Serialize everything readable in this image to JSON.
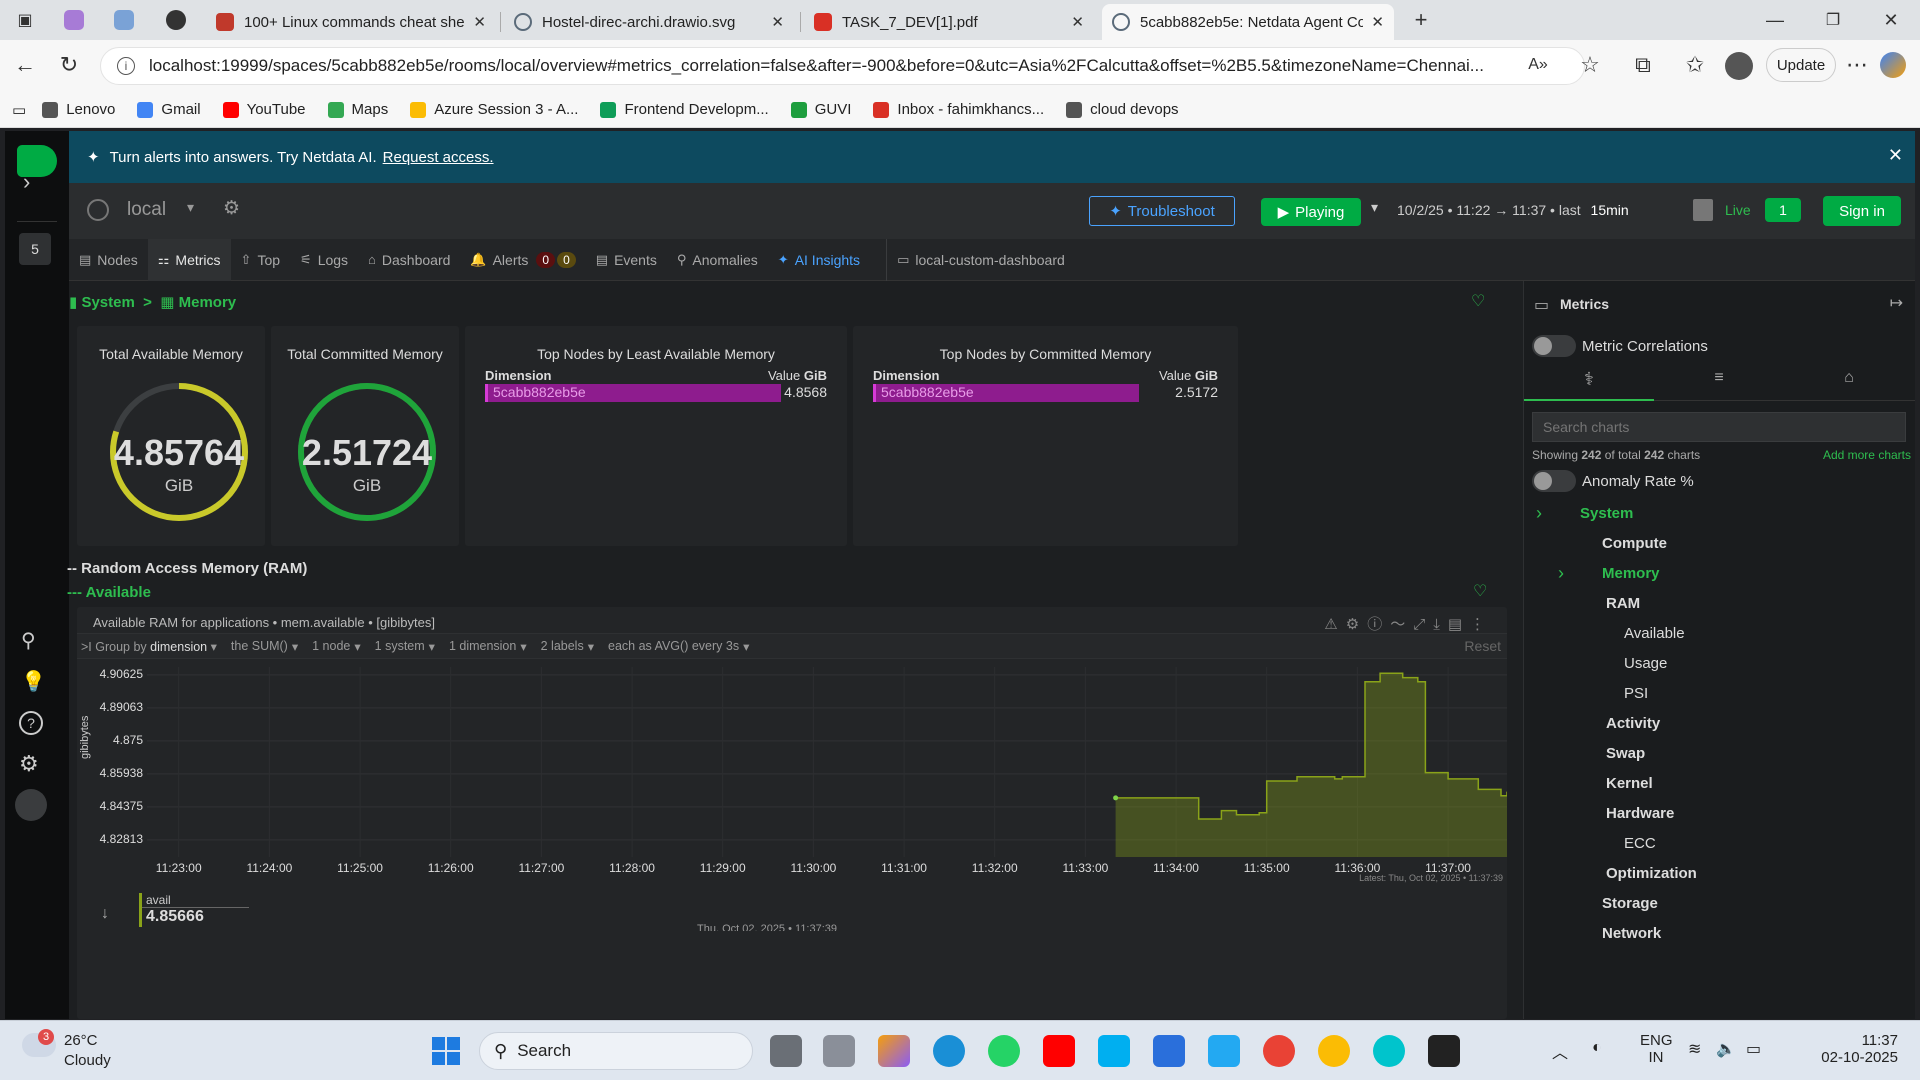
{
  "browser": {
    "tabs": [
      {
        "title": "100+ Linux commands cheat shee",
        "color": "#c0392b"
      },
      {
        "title": "Hostel-direc-archi.drawio.svg",
        "color": "#5b6b7a"
      },
      {
        "title": "TASK_7_DEV[1].pdf",
        "color": "#d93025"
      },
      {
        "title": "5cabb882eb5e: Netdata Agent Co",
        "color": "#5b6b7a"
      }
    ],
    "url": "localhost:19999/spaces/5cabb882eb5e/rooms/local/overview#metrics_correlation=false&after=-900&before=0&utc=Asia%2FCalcutta&offset=%2B5.5&timezoneName=Chennai...",
    "update_label": "Update",
    "bookmarks": [
      {
        "label": "Lenovo",
        "icon": "folder-icon",
        "color": "#555"
      },
      {
        "label": "Gmail",
        "icon": "google-icon",
        "color": "#4285f4"
      },
      {
        "label": "YouTube",
        "icon": "youtube-icon",
        "color": "#ff0000"
      },
      {
        "label": "Maps",
        "icon": "maps-icon",
        "color": "#34a853"
      },
      {
        "label": "Azure Session 3 - A...",
        "icon": "drive-icon",
        "color": "#fbbc04"
      },
      {
        "label": "Frontend Developm...",
        "icon": "sheets-icon",
        "color": "#0f9d58"
      },
      {
        "label": "GUVI",
        "icon": "guvi-icon",
        "color": "#1e9e3e"
      },
      {
        "label": "Inbox - fahimkhancs...",
        "icon": "gmail-icon",
        "color": "#d93025"
      },
      {
        "label": "cloud devops",
        "icon": "folder-icon",
        "color": "#555"
      }
    ]
  },
  "app": {
    "left_badge": "5",
    "banner_text": "Turn alerts into answers. Try Netdata AI.",
    "banner_link": "Request access.",
    "room_name": "local",
    "troubleshoot_label": "Troubleshoot",
    "playing_label": "Playing",
    "time_range": "10/2/25 • 11:22 → 11:37 • last",
    "time_window": "15min",
    "live_label": "Live",
    "live_count": "1",
    "signin_label": "Sign in",
    "tabs": [
      {
        "label": "Nodes",
        "icon": "nodes-icon"
      },
      {
        "label": "Metrics",
        "icon": "metrics-icon"
      },
      {
        "label": "Top",
        "icon": "top-icon"
      },
      {
        "label": "Logs",
        "icon": "logs-icon"
      },
      {
        "label": "Dashboard",
        "icon": "dashboard-icon"
      },
      {
        "label": "Alerts",
        "icon": "bell-icon"
      },
      {
        "label": "Events",
        "icon": "events-icon"
      },
      {
        "label": "Anomalies",
        "icon": "anomalies-icon"
      },
      {
        "label": "AI Insights",
        "icon": "sparkle-icon"
      },
      {
        "label": "local-custom-dashboard",
        "icon": "screen-icon"
      }
    ],
    "alerts_critical": "0",
    "alerts_warning": "0",
    "breadcrumb": {
      "system": "System",
      "memory": "Memory"
    },
    "cards": {
      "total_available": {
        "title": "Total Available Memory",
        "value": "4.85764",
        "unit": "GiB",
        "fraction": 0.8,
        "color": "#c9c92a"
      },
      "total_committed": {
        "title": "Total Committed Memory",
        "value": "2.51724",
        "unit": "GiB",
        "fraction": 1.0,
        "color": "#1fa43a"
      },
      "least_available": {
        "title": "Top Nodes by Least Available Memory",
        "dim_label": "Dimension",
        "value_label": "Value",
        "unit_label": "GiB",
        "node": "5cabb882eb5e",
        "value": "4.8568"
      },
      "committed": {
        "title": "Top Nodes by Committed Memory",
        "dim_label": "Dimension",
        "value_label": "Value",
        "unit_label": "GiB",
        "node": "5cabb882eb5e",
        "value": "2.5172"
      }
    },
    "section_ram": "-- Random Access Memory (RAM)",
    "section_available": "--- Available",
    "chart_panel": {
      "title": "Available RAM for applications • mem.available • [gibibytes]",
      "group_by_prefix": "Group by",
      "group_by": "dimension",
      "agg": "the SUM()",
      "nodes": "1 node",
      "system": "1 system",
      "dimension": "1 dimension",
      "labels": "2 labels",
      "each_as": "each as AVG() every 3s",
      "reset": "Reset",
      "latest": "Latest: Thu, Oct 02, 2025 • 11:37:39",
      "legend_name": "avail",
      "legend_value": "4.85666",
      "footer_date": "Thu, Oct 02, 2025 • 11:37:39"
    },
    "right_panel": {
      "title": "Metrics",
      "metric_correlations": "Metric Correlations",
      "search_placeholder": "Search charts",
      "showing_prefix": "Showing",
      "showing_count": "242",
      "showing_mid": "of total",
      "showing_total": "242",
      "showing_suffix": "charts",
      "add_more": "Add more charts",
      "anomaly_rate": "Anomaly Rate %",
      "tree": [
        {
          "label": "System",
          "level": 0,
          "green": true
        },
        {
          "label": "Compute",
          "level": 1
        },
        {
          "label": "Memory",
          "level": 1,
          "green": true
        },
        {
          "label": "RAM",
          "level": 2
        },
        {
          "label": "Available",
          "level": 3
        },
        {
          "label": "Usage",
          "level": 3
        },
        {
          "label": "PSI",
          "level": 3
        },
        {
          "label": "Activity",
          "level": 2
        },
        {
          "label": "Swap",
          "level": 2
        },
        {
          "label": "Kernel",
          "level": 2
        },
        {
          "label": "Hardware",
          "level": 2
        },
        {
          "label": "ECC",
          "level": 3
        },
        {
          "label": "Optimization",
          "level": 2
        },
        {
          "label": "Storage",
          "level": 1
        },
        {
          "label": "Network",
          "level": 1
        }
      ]
    }
  },
  "chart_data": {
    "type": "area",
    "title": "Available RAM for applications • mem.available • [gibibytes]",
    "ylabel": "gibibytes",
    "y_ticks": [
      "4.90625",
      "4.89063",
      "4.875",
      "4.85938",
      "4.84375",
      "4.82813"
    ],
    "x_ticks": [
      "11:23:00",
      "11:24:00",
      "11:25:00",
      "11:26:00",
      "11:27:00",
      "11:28:00",
      "11:29:00",
      "11:30:00",
      "11:31:00",
      "11:32:00",
      "11:33:00",
      "11:34:00",
      "11:35:00",
      "11:36:00",
      "11:37:00"
    ],
    "ylim": [
      4.82,
      4.91
    ],
    "series": [
      {
        "name": "avail",
        "color": "#8aa319",
        "x": [
          "11:33:20",
          "11:34:10",
          "11:34:15",
          "11:34:30",
          "11:34:40",
          "11:34:55",
          "11:35:00",
          "11:35:10",
          "11:35:20",
          "11:35:35",
          "11:35:45",
          "11:35:50",
          "11:35:55",
          "11:36:05",
          "11:36:15",
          "11:36:30",
          "11:36:40",
          "11:36:45",
          "11:37:00",
          "11:37:20",
          "11:37:35",
          "11:37:39"
        ],
        "y": [
          4.848,
          4.848,
          4.838,
          4.842,
          4.84,
          4.841,
          4.856,
          4.856,
          4.858,
          4.858,
          4.857,
          4.858,
          4.858,
          4.903,
          4.907,
          4.905,
          4.903,
          4.86,
          4.857,
          4.852,
          4.849,
          4.851
        ]
      }
    ]
  },
  "taskbar": {
    "temperature": "26°C",
    "condition": "Cloudy",
    "weather_badge": "3",
    "search_label": "Search",
    "lang_1": "ENG",
    "lang_2": "IN",
    "time": "11:37",
    "date": "02-10-2025"
  }
}
